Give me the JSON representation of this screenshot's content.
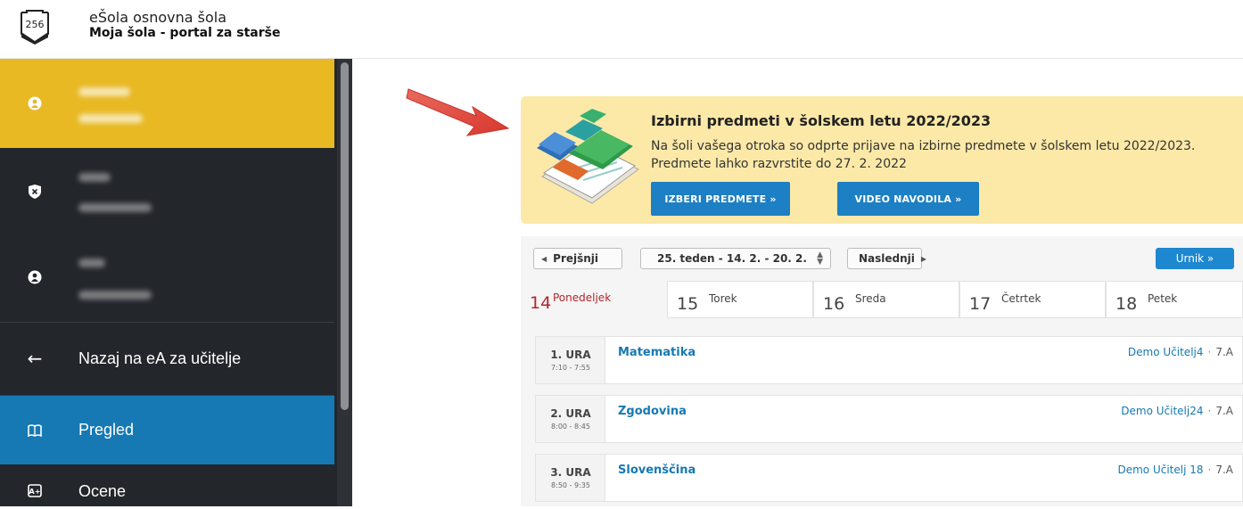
{
  "header": {
    "logo_text": "256",
    "school_name": "eŠola osnovna šola",
    "portal_name": "Moja šola - portal za starše"
  },
  "sidebar": {
    "children": [
      {
        "icon": "child-icon"
      },
      {
        "icon": "shield-icon"
      },
      {
        "icon": "child-icon"
      }
    ],
    "back_label": "Nazaj na eA za učitelje",
    "items": [
      {
        "label": "Pregled",
        "icon": "book-icon",
        "active": true
      },
      {
        "label": "Ocene",
        "icon": "grade-icon",
        "active": false
      }
    ]
  },
  "banner": {
    "title": "Izbirni predmeti v šolskem letu 2022/2023",
    "text": "Na šoli vašega otroka so odprte prijave na izbirne predmete v šolskem letu 2022/2023.\nPredmete lahko razvrstite do 27. 2. 2022",
    "button_choose": "IZBERI PREDMETE »",
    "button_video": "VIDEO NAVODILA »"
  },
  "schedule": {
    "prev_label": "Prejšnji",
    "week_label": "25. teden - 14. 2. - 20. 2.",
    "next_label": "Naslednji",
    "urnik_label": "Urnik »",
    "days": [
      {
        "num": "14",
        "name": "Ponedeljek"
      },
      {
        "num": "15",
        "name": "Torek"
      },
      {
        "num": "16",
        "name": "Sreda"
      },
      {
        "num": "17",
        "name": "Četrtek"
      },
      {
        "num": "18",
        "name": "Petek"
      }
    ],
    "lessons": [
      {
        "hour": "1. URA",
        "time": "7:10 - 7:55",
        "subject": "Matematika",
        "teacher": "Demo Učitelj4",
        "separator": "·",
        "class": "7.A"
      },
      {
        "hour": "2. URA",
        "time": "8:00 - 8:45",
        "subject": "Zgodovina",
        "teacher": "Demo Učitelj24",
        "separator": "·",
        "class": "7.A"
      },
      {
        "hour": "3. URA",
        "time": "8:50 - 9:35",
        "subject": "Slovenščina",
        "teacher": "Demo Učitelj 18",
        "separator": "·",
        "class": "7.A"
      }
    ]
  },
  "colors": {
    "accent_yellow": "#e8b923",
    "active_blue": "#1679b3",
    "banner_bg": "#fce9a8",
    "arrow_red": "#e2463c",
    "today_red": "#b2262a"
  }
}
